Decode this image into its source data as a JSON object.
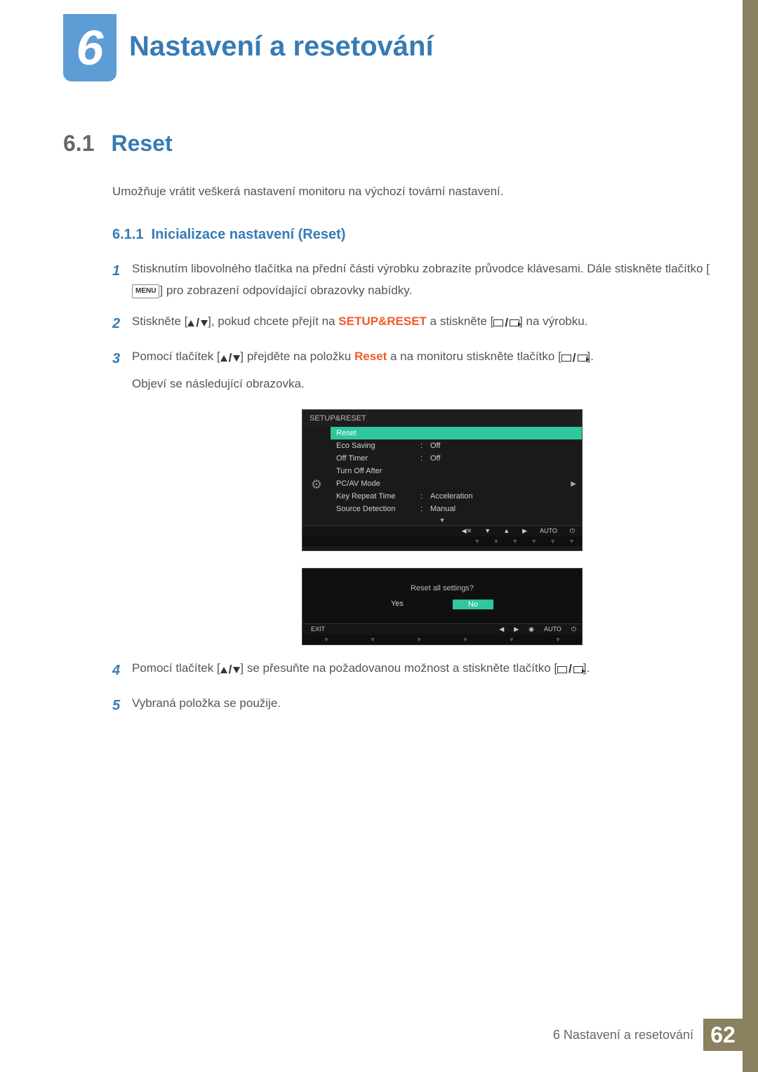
{
  "chapter_number": "6",
  "chapter_title": "Nastavení a resetování",
  "section": {
    "number": "6.1",
    "title": "Reset",
    "description": "Umožňuje vrátit veškerá nastavení monitoru na výchozí tovární nastavení."
  },
  "subsection": {
    "number": "6.1.1",
    "title": "Inicializace nastavení (Reset)"
  },
  "steps": {
    "s1a": "Stisknutím libovolného tlačítka na přední části výrobku zobrazíte průvodce klávesami. Dále stiskněte tlačítko [",
    "s1_menu": "MENU",
    "s1b": "] pro zobrazení odpovídající obrazovky nabídky.",
    "s2a": "Stiskněte [",
    "s2b": "], pokud chcete přejít na ",
    "s2_hl": "SETUP&RESET",
    "s2c": " a stiskněte [",
    "s2d": "] na výrobku.",
    "s3a": "Pomocí tlačítek [",
    "s3b": "] přejděte na položku ",
    "s3_hl": "Reset",
    "s3c": " a na monitoru stiskněte tlačítko [",
    "s3d": "].",
    "s3e": "Objeví se následující obrazovka.",
    "s4a": "Pomocí tlačítek [",
    "s4b": "] se přesuňte na požadovanou možnost a stiskněte tlačítko [",
    "s4c": "].",
    "s5": "Vybraná položka se použije."
  },
  "osd1": {
    "title": "SETUP&RESET",
    "rows": [
      {
        "label": "Reset",
        "val": "",
        "sel": true
      },
      {
        "label": "Eco Saving",
        "val": "Off"
      },
      {
        "label": "Off Timer",
        "val": "Off"
      },
      {
        "label": "Turn Off After",
        "val": ""
      },
      {
        "label": "PC/AV Mode",
        "val": ""
      },
      {
        "label": "Key Repeat Time",
        "val": "Acceleration"
      },
      {
        "label": "Source Detection",
        "val": "Manual"
      }
    ],
    "auto": "AUTO"
  },
  "osd2": {
    "question": "Reset all settings?",
    "yes": "Yes",
    "no": "No",
    "exit": "EXIT",
    "auto": "AUTO"
  },
  "footer": {
    "label": "6 Nastavení a resetování",
    "page": "62"
  }
}
